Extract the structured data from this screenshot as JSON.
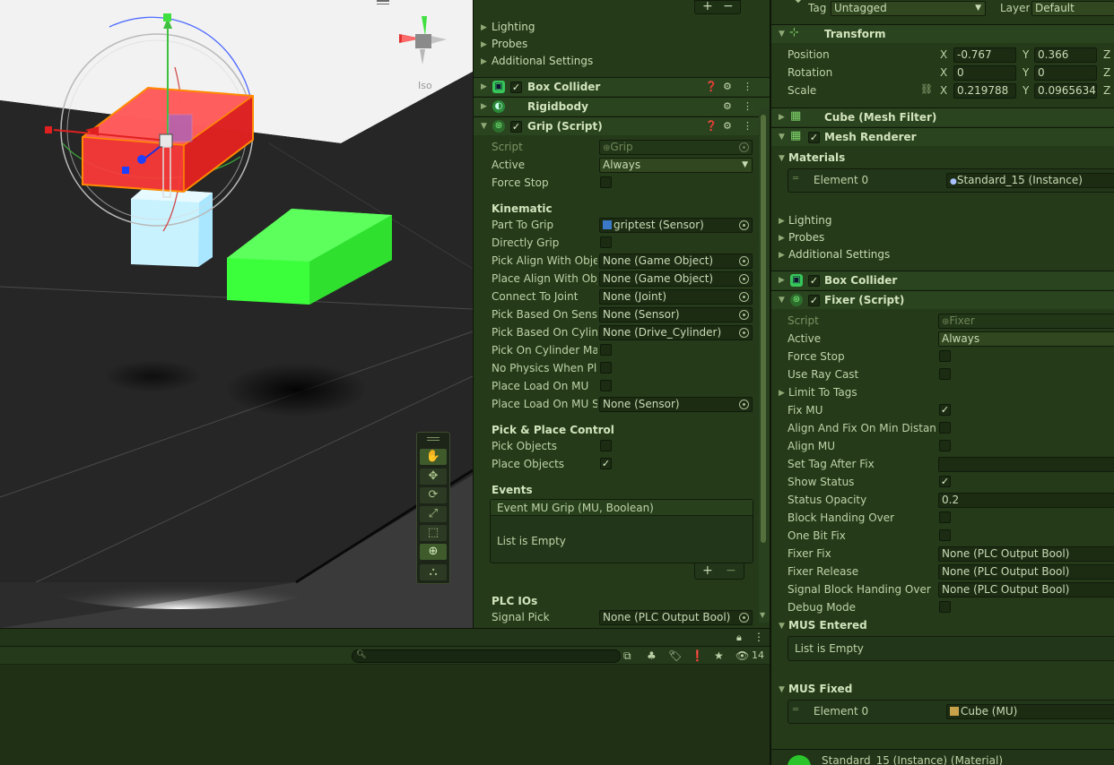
{
  "scene": {
    "iso_label": "Iso"
  },
  "console": {
    "search_placeholder": "",
    "hidden_count": "14"
  },
  "mid": {
    "top_sections": [
      "Lighting",
      "Probes",
      "Additional Settings"
    ],
    "components": [
      {
        "name": "Box Collider",
        "checked": true
      },
      {
        "name": "Rigidbody",
        "checked": false
      },
      {
        "name": "Grip (Script)",
        "checked": true
      }
    ],
    "grip": {
      "script_label": "Script",
      "script_value": "Grip",
      "active_label": "Active",
      "active_value": "Always",
      "force_stop_label": "Force Stop",
      "kinematic_title": "Kinematic",
      "part_to_grip_label": "Part To Grip",
      "part_to_grip_value": "griptest (Sensor)",
      "directly_grip_label": "Directly Grip",
      "pick_align_label": "Pick Align With Objec",
      "pick_align_value": "None (Game Object)",
      "place_align_label": "Place Align With Obje",
      "place_align_value": "None (Game Object)",
      "connect_joint_label": "Connect To Joint",
      "connect_joint_value": "None (Joint)",
      "pick_sensor_label": "Pick Based On Senso",
      "pick_sensor_value": "None (Sensor)",
      "pick_cyl_label": "Pick Based On Cylinc",
      "pick_cyl_value": "None (Drive_Cylinder)",
      "pick_cyl_max_label": "Pick On Cylinder Max",
      "no_physics_label": "No Physics When Pla",
      "place_load_label": "Place Load On MU",
      "place_load_se_label": "Place Load On MU Se",
      "place_load_se_value": "None (Sensor)",
      "pickplace_title": "Pick & Place Control",
      "pick_objects_label": "Pick Objects",
      "place_objects_label": "Place Objects",
      "events_title": "Events",
      "event_name": "Event MU Grip (MU, Boolean)",
      "event_empty": "List is Empty",
      "plc_title": "PLC IOs",
      "signal_pick_label": "Signal Pick",
      "signal_pick_value": "None (PLC Output Bool)"
    }
  },
  "right": {
    "tag_label": "Tag",
    "tag_value": "Untagged",
    "layer_label": "Layer",
    "layer_value": "Default",
    "transform_title": "Transform",
    "position_label": "Position",
    "position_x": "-0.767",
    "position_y": "0.366",
    "rotation_label": "Rotation",
    "rotation_x": "0",
    "rotation_y": "0",
    "scale_label": "Scale",
    "scale_x": "0.219788",
    "scale_y": "0.0965634'",
    "axis_x": "X",
    "axis_y": "Y",
    "axis_z": "Z",
    "mesh_filter": "Cube (Mesh Filter)",
    "mesh_renderer": "Mesh Renderer",
    "materials_label": "Materials",
    "element0_label": "Element 0",
    "material0_value": "Standard_15 (Instance)",
    "sections": [
      "Lighting",
      "Probes",
      "Additional Settings"
    ],
    "box_collider": "Box Collider",
    "fixer_title": "Fixer (Script)",
    "fixer": {
      "script_label": "Script",
      "script_value": "Fixer",
      "active_label": "Active",
      "active_value": "Always",
      "force_stop_label": "Force Stop",
      "use_raycast_label": "Use Ray Cast",
      "limit_tags_label": "Limit To Tags",
      "fix_mu_label": "Fix MU",
      "align_fix_label": "Align And Fix On Min Distance",
      "align_mu_label": "Align MU",
      "set_tag_label": "Set Tag After Fix",
      "show_status_label": "Show Status",
      "status_opacity_label": "Status Opacity",
      "status_opacity_value": "0.2",
      "block_handing_label": "Block Handing Over",
      "one_bit_label": "One Bit Fix",
      "fixer_fix_label": "Fixer Fix",
      "fixer_fix_value": "None (PLC Output Bool)",
      "fixer_release_label": "Fixer Release",
      "fixer_release_value": "None (PLC Output Bool)",
      "signal_block_label": "Signal Block Handing Over",
      "signal_block_value": "None (PLC Output Bool)",
      "debug_mode_label": "Debug Mode",
      "mus_entered_label": "MUS Entered",
      "mus_entered_empty": "List is Empty",
      "mus_fixed_label": "MUS Fixed",
      "mus_fixed_element_label": "Element 0",
      "mus_fixed_value": "Cube (MU)"
    },
    "material_footer": "Standard_15 (Instance) (Material)"
  },
  "colors": {
    "panel": "#243a19",
    "header": "#2b4420",
    "accent_green": "#39ff3a"
  }
}
